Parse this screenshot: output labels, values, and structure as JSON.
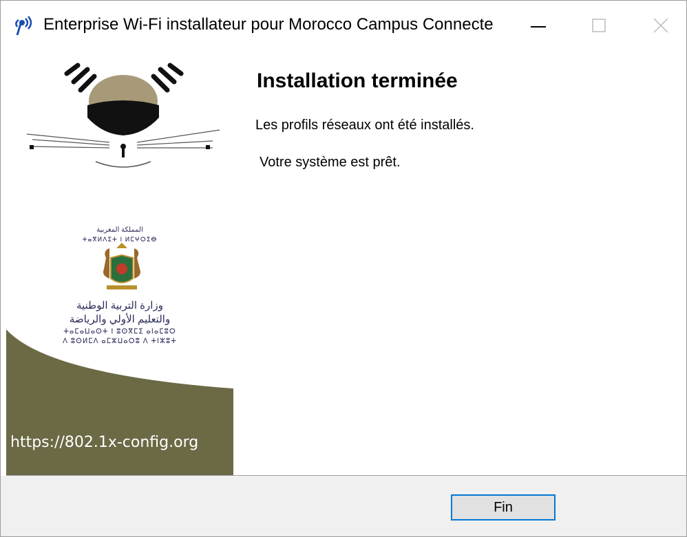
{
  "window": {
    "title": "Enterprise Wi-Fi installateur pour Morocco Campus Connecte",
    "icon": "wifi-signal-icon",
    "controls": {
      "minimize": "minimize-icon",
      "maximize": "maximize-icon",
      "close": "close-icon"
    }
  },
  "banner": {
    "url": "https://802.1x-config.org",
    "logo": "campus-logo",
    "emblem": "moroccan-coat-of-arms-icon",
    "ministry_arabic_top": "المملكة المغربية",
    "ministry_arabic_line1": "وزارة التربية الوطنية",
    "ministry_arabic_line2": "والتعليم الأولي والرياضة",
    "colors": {
      "olive": "#6b6a45",
      "logo_dark": "#1a1a1a",
      "logo_tan": "#a89a78"
    }
  },
  "content": {
    "heading": "Installation terminée",
    "message1": "Les profils réseaux ont été installés.",
    "message2": "Votre système est prêt."
  },
  "footer": {
    "fin_label": "Fin",
    "accent": "#0078d7"
  }
}
